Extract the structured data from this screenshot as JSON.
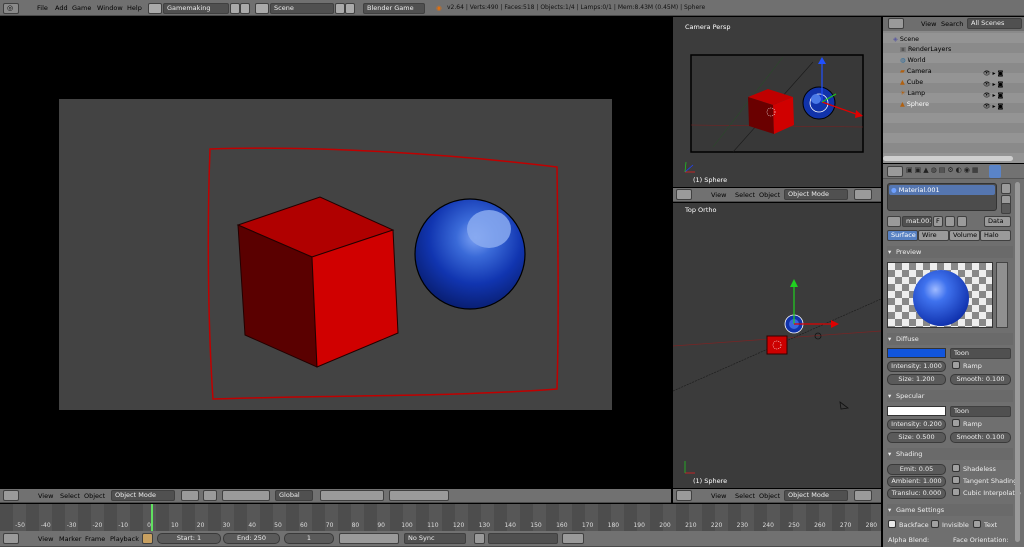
{
  "topbar": {
    "menus": [
      "File",
      "Add",
      "Game",
      "Window",
      "Help"
    ],
    "screen": "Gamemaking",
    "scene": "Scene",
    "engine": "Blender Game",
    "stats": "v2.64 | Verts:490 | Faces:518 | Objects:1/4 | Lamps:0/1 | Mem:8.43M (0.45M) | Sphere"
  },
  "camera_view": {
    "label": "Camera Persp",
    "object": "(1) Sphere"
  },
  "top_view": {
    "label": "Top Ortho",
    "object": "(1) Sphere"
  },
  "view_header": {
    "view": "View",
    "select": "Select",
    "object": "Object",
    "mode": "Object Mode"
  },
  "main_header": {
    "view": "View",
    "select": "Select",
    "object": "Object",
    "mode": "Object Mode",
    "orientation": "Global"
  },
  "outliner": {
    "view": "View",
    "search": "Search",
    "filter": "All Scenes",
    "items": [
      {
        "label": "Scene",
        "indent": 0
      },
      {
        "label": "RenderLayers",
        "indent": 1
      },
      {
        "label": "World",
        "indent": 1
      },
      {
        "label": "Camera",
        "indent": 1
      },
      {
        "label": "Cube",
        "indent": 1
      },
      {
        "label": "Lamp",
        "indent": 1
      },
      {
        "label": "Sphere",
        "indent": 1
      }
    ]
  },
  "properties": {
    "material_slot": "Material.001",
    "material_name": "mat.001",
    "f_label": "F",
    "data_label": "Data",
    "tabs": [
      "Surface",
      "Wire",
      "Volume",
      "Halo"
    ],
    "preview_title": "Preview",
    "diffuse": {
      "title": "Diffuse",
      "color": "#1155dd",
      "shader": "Toon",
      "intensity": "Intensity: 1.000",
      "ramp": "Ramp",
      "size": "Size: 1.200",
      "smooth": "Smooth: 0.100"
    },
    "specular": {
      "title": "Specular",
      "color": "#ffffff",
      "shader": "Toon",
      "intensity": "Intensity: 0.200",
      "ramp": "Ramp",
      "size": "Size: 0.500",
      "smooth": "Smooth: 0.100"
    },
    "shading": {
      "title": "Shading",
      "emit": "Emit: 0.05",
      "shadeless": "Shadeless",
      "ambient": "Ambient: 1.000",
      "tangent": "Tangent Shading",
      "translucency": "Transluc: 0.000",
      "cubic": "Cubic Interpolatio"
    },
    "game": {
      "title": "Game Settings",
      "backface": "Backface",
      "invisible": "Invisible",
      "text": "Text",
      "alpha_blend": "Alpha Blend:",
      "face_orientation": "Face Orientation:"
    }
  },
  "timeline": {
    "ticks": [
      "-50",
      "-40",
      "-30",
      "-20",
      "-10",
      "0",
      "10",
      "20",
      "30",
      "40",
      "50",
      "60",
      "70",
      "80",
      "90",
      "100",
      "110",
      "120",
      "130",
      "140",
      "150",
      "160",
      "170",
      "180",
      "190",
      "200",
      "210",
      "220",
      "230",
      "240",
      "250",
      "260",
      "270",
      "280"
    ],
    "view": "View",
    "marker": "Marker",
    "frame": "Frame",
    "playback": "Playback",
    "start": "Start: 1",
    "end": "End: 250",
    "current": "1",
    "sync": "No Sync"
  }
}
